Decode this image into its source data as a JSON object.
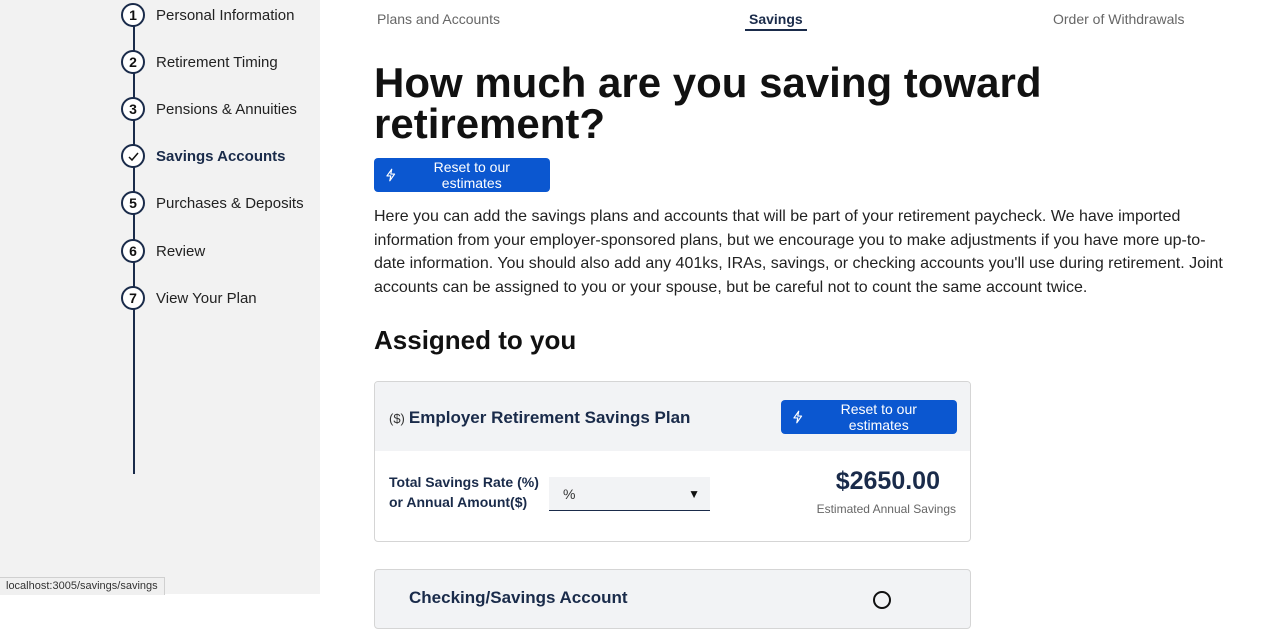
{
  "sidebar": {
    "steps": [
      {
        "number": "1",
        "label": "Personal Information"
      },
      {
        "number": "2",
        "label": "Retirement Timing"
      },
      {
        "number": "3",
        "label": "Pensions & Annuities"
      },
      {
        "number": "",
        "label": "Savings Accounts",
        "state": "current",
        "icon": "check-icon"
      },
      {
        "number": "5",
        "label": "Purchases & Deposits"
      },
      {
        "number": "6",
        "label": "Review"
      },
      {
        "number": "7",
        "label": "View Your Plan"
      }
    ]
  },
  "topnav": {
    "tabs": [
      {
        "label": "Plans and Accounts"
      },
      {
        "label": "Savings",
        "active": true
      },
      {
        "label": "Order of Withdrawals"
      }
    ]
  },
  "page": {
    "title": "How much are you saving toward retirement?",
    "reset_label": "Reset to our estimates",
    "intro": "Here you can add the savings plans and accounts that will be part of your retirement paycheck. We have imported information from your employer-sponsored plans, but we encourage you to make adjustments if you have more up-to-date information. You should also add any 401ks, IRAs, savings, or checking accounts you'll use during retirement. Joint accounts can be assigned to you or your spouse, but be careful not to count the same account twice.",
    "section_title": "Assigned to you"
  },
  "card": {
    "prefix": "($)",
    "title": "Employer Retirement Savings Plan",
    "reset_label": "Reset to our estimates",
    "rate_label_line1": "Total Savings Rate (%)",
    "rate_label_line2": "or Annual Amount($)",
    "select_value": "%",
    "amount": "$2650.00",
    "amount_caption": "Estimated Annual Savings"
  },
  "card2": {
    "title": "Checking/Savings Account"
  },
  "statusbar": {
    "url": "localhost:3005/savings/savings"
  },
  "colors": {
    "primary_button": "#0b57d0",
    "navy": "#1a2b4a",
    "sidebar_bg": "#f2f2f2"
  }
}
